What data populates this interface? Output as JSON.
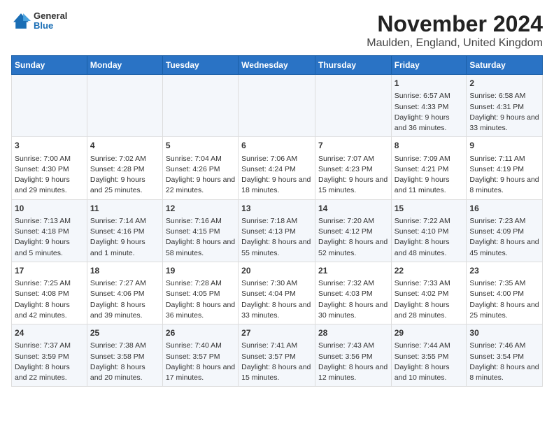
{
  "logo": {
    "general": "General",
    "blue": "Blue"
  },
  "title": "November 2024",
  "subtitle": "Maulden, England, United Kingdom",
  "headers": [
    "Sunday",
    "Monday",
    "Tuesday",
    "Wednesday",
    "Thursday",
    "Friday",
    "Saturday"
  ],
  "weeks": [
    [
      {
        "day": "",
        "sunrise": "",
        "sunset": "",
        "daylight": ""
      },
      {
        "day": "",
        "sunrise": "",
        "sunset": "",
        "daylight": ""
      },
      {
        "day": "",
        "sunrise": "",
        "sunset": "",
        "daylight": ""
      },
      {
        "day": "",
        "sunrise": "",
        "sunset": "",
        "daylight": ""
      },
      {
        "day": "",
        "sunrise": "",
        "sunset": "",
        "daylight": ""
      },
      {
        "day": "1",
        "sunrise": "Sunrise: 6:57 AM",
        "sunset": "Sunset: 4:33 PM",
        "daylight": "Daylight: 9 hours and 36 minutes."
      },
      {
        "day": "2",
        "sunrise": "Sunrise: 6:58 AM",
        "sunset": "Sunset: 4:31 PM",
        "daylight": "Daylight: 9 hours and 33 minutes."
      }
    ],
    [
      {
        "day": "3",
        "sunrise": "Sunrise: 7:00 AM",
        "sunset": "Sunset: 4:30 PM",
        "daylight": "Daylight: 9 hours and 29 minutes."
      },
      {
        "day": "4",
        "sunrise": "Sunrise: 7:02 AM",
        "sunset": "Sunset: 4:28 PM",
        "daylight": "Daylight: 9 hours and 25 minutes."
      },
      {
        "day": "5",
        "sunrise": "Sunrise: 7:04 AM",
        "sunset": "Sunset: 4:26 PM",
        "daylight": "Daylight: 9 hours and 22 minutes."
      },
      {
        "day": "6",
        "sunrise": "Sunrise: 7:06 AM",
        "sunset": "Sunset: 4:24 PM",
        "daylight": "Daylight: 9 hours and 18 minutes."
      },
      {
        "day": "7",
        "sunrise": "Sunrise: 7:07 AM",
        "sunset": "Sunset: 4:23 PM",
        "daylight": "Daylight: 9 hours and 15 minutes."
      },
      {
        "day": "8",
        "sunrise": "Sunrise: 7:09 AM",
        "sunset": "Sunset: 4:21 PM",
        "daylight": "Daylight: 9 hours and 11 minutes."
      },
      {
        "day": "9",
        "sunrise": "Sunrise: 7:11 AM",
        "sunset": "Sunset: 4:19 PM",
        "daylight": "Daylight: 9 hours and 8 minutes."
      }
    ],
    [
      {
        "day": "10",
        "sunrise": "Sunrise: 7:13 AM",
        "sunset": "Sunset: 4:18 PM",
        "daylight": "Daylight: 9 hours and 5 minutes."
      },
      {
        "day": "11",
        "sunrise": "Sunrise: 7:14 AM",
        "sunset": "Sunset: 4:16 PM",
        "daylight": "Daylight: 9 hours and 1 minute."
      },
      {
        "day": "12",
        "sunrise": "Sunrise: 7:16 AM",
        "sunset": "Sunset: 4:15 PM",
        "daylight": "Daylight: 8 hours and 58 minutes."
      },
      {
        "day": "13",
        "sunrise": "Sunrise: 7:18 AM",
        "sunset": "Sunset: 4:13 PM",
        "daylight": "Daylight: 8 hours and 55 minutes."
      },
      {
        "day": "14",
        "sunrise": "Sunrise: 7:20 AM",
        "sunset": "Sunset: 4:12 PM",
        "daylight": "Daylight: 8 hours and 52 minutes."
      },
      {
        "day": "15",
        "sunrise": "Sunrise: 7:22 AM",
        "sunset": "Sunset: 4:10 PM",
        "daylight": "Daylight: 8 hours and 48 minutes."
      },
      {
        "day": "16",
        "sunrise": "Sunrise: 7:23 AM",
        "sunset": "Sunset: 4:09 PM",
        "daylight": "Daylight: 8 hours and 45 minutes."
      }
    ],
    [
      {
        "day": "17",
        "sunrise": "Sunrise: 7:25 AM",
        "sunset": "Sunset: 4:08 PM",
        "daylight": "Daylight: 8 hours and 42 minutes."
      },
      {
        "day": "18",
        "sunrise": "Sunrise: 7:27 AM",
        "sunset": "Sunset: 4:06 PM",
        "daylight": "Daylight: 8 hours and 39 minutes."
      },
      {
        "day": "19",
        "sunrise": "Sunrise: 7:28 AM",
        "sunset": "Sunset: 4:05 PM",
        "daylight": "Daylight: 8 hours and 36 minutes."
      },
      {
        "day": "20",
        "sunrise": "Sunrise: 7:30 AM",
        "sunset": "Sunset: 4:04 PM",
        "daylight": "Daylight: 8 hours and 33 minutes."
      },
      {
        "day": "21",
        "sunrise": "Sunrise: 7:32 AM",
        "sunset": "Sunset: 4:03 PM",
        "daylight": "Daylight: 8 hours and 30 minutes."
      },
      {
        "day": "22",
        "sunrise": "Sunrise: 7:33 AM",
        "sunset": "Sunset: 4:02 PM",
        "daylight": "Daylight: 8 hours and 28 minutes."
      },
      {
        "day": "23",
        "sunrise": "Sunrise: 7:35 AM",
        "sunset": "Sunset: 4:00 PM",
        "daylight": "Daylight: 8 hours and 25 minutes."
      }
    ],
    [
      {
        "day": "24",
        "sunrise": "Sunrise: 7:37 AM",
        "sunset": "Sunset: 3:59 PM",
        "daylight": "Daylight: 8 hours and 22 minutes."
      },
      {
        "day": "25",
        "sunrise": "Sunrise: 7:38 AM",
        "sunset": "Sunset: 3:58 PM",
        "daylight": "Daylight: 8 hours and 20 minutes."
      },
      {
        "day": "26",
        "sunrise": "Sunrise: 7:40 AM",
        "sunset": "Sunset: 3:57 PM",
        "daylight": "Daylight: 8 hours and 17 minutes."
      },
      {
        "day": "27",
        "sunrise": "Sunrise: 7:41 AM",
        "sunset": "Sunset: 3:57 PM",
        "daylight": "Daylight: 8 hours and 15 minutes."
      },
      {
        "day": "28",
        "sunrise": "Sunrise: 7:43 AM",
        "sunset": "Sunset: 3:56 PM",
        "daylight": "Daylight: 8 hours and 12 minutes."
      },
      {
        "day": "29",
        "sunrise": "Sunrise: 7:44 AM",
        "sunset": "Sunset: 3:55 PM",
        "daylight": "Daylight: 8 hours and 10 minutes."
      },
      {
        "day": "30",
        "sunrise": "Sunrise: 7:46 AM",
        "sunset": "Sunset: 3:54 PM",
        "daylight": "Daylight: 8 hours and 8 minutes."
      }
    ]
  ]
}
